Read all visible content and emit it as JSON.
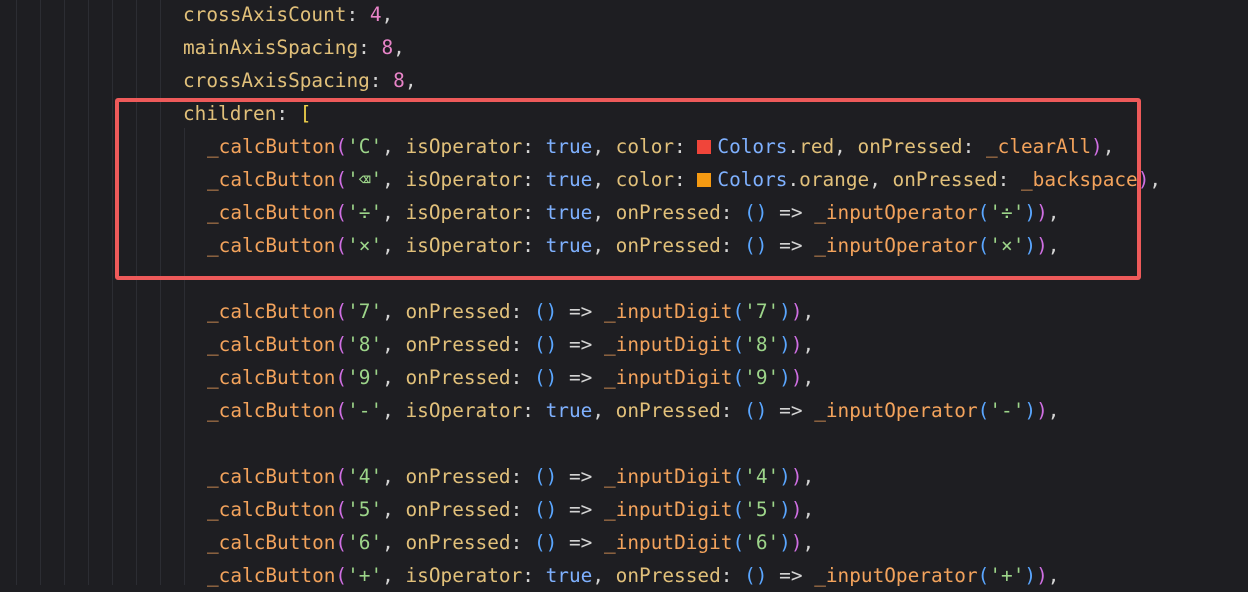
{
  "code": {
    "lines": [
      {
        "id": "l1",
        "text": "crossAxisCount: 4,"
      },
      {
        "id": "l2",
        "text": "mainAxisSpacing: 8,"
      },
      {
        "id": "l3",
        "text": "crossAxisSpacing: 8,"
      },
      {
        "id": "l4",
        "text": "children: ["
      },
      {
        "id": "l5",
        "text": "_calcButton('C', isOperator: true, color: Colors.red, onPressed: _clearAll),"
      },
      {
        "id": "l6",
        "text": "_calcButton('⌫', isOperator: true, color: Colors.orange, onPressed: _backspace),"
      },
      {
        "id": "l7",
        "text": "_calcButton('÷', isOperator: true, onPressed: () => _inputOperator('÷')),"
      },
      {
        "id": "l8",
        "text": "_calcButton('×', isOperator: true, onPressed: () => _inputOperator('×')),"
      },
      {
        "id": "l9",
        "text": "_calcButton('7', onPressed: () => _inputDigit('7')),"
      },
      {
        "id": "l10",
        "text": "_calcButton('8', onPressed: () => _inputDigit('8')),"
      },
      {
        "id": "l11",
        "text": "_calcButton('9', onPressed: () => _inputDigit('9')),"
      },
      {
        "id": "l12",
        "text": "_calcButton('-', isOperator: true, onPressed: () => _inputOperator('-')),"
      },
      {
        "id": "l13",
        "text": "_calcButton('4', onPressed: () => _inputDigit('4')),"
      },
      {
        "id": "l14",
        "text": "_calcButton('5', onPressed: () => _inputDigit('5')),"
      },
      {
        "id": "l15",
        "text": "_calcButton('6', onPressed: () => _inputDigit('6')),"
      },
      {
        "id": "l16",
        "text": "_calcButton('+', isOperator: true, onPressed: () => _inputOperator('+')),"
      }
    ]
  },
  "colors": {
    "background": "#1e1e22",
    "highlight_border": "#ee5a5a",
    "red_swatch": "#f0453a",
    "orange_swatch": "#f59a12"
  },
  "tokens": {
    "crossAxisCount": "crossAxisCount",
    "mainAxisSpacing": "mainAxisSpacing",
    "crossAxisSpacing": "crossAxisSpacing",
    "children": "children",
    "calcButton": "_calcButton",
    "isOperator": "isOperator",
    "true": "true",
    "color": "color",
    "onPressed": "onPressed",
    "Colors": "Colors",
    "red": "red",
    "orange": "orange",
    "clearAll": "_clearAll",
    "backspace": "_backspace",
    "inputOperator": "_inputOperator",
    "inputDigit": "_inputDigit",
    "arrow": "=>",
    "v4": "4",
    "v8": "8",
    "sC": "'C'",
    "sBack": "'⌫'",
    "sDiv": "'÷'",
    "sMul": "'×'",
    "s7": "'7'",
    "s8": "'8'",
    "s9": "'9'",
    "sMinus": "'-'",
    "s4": "'4'",
    "s5": "'5'",
    "s6": "'6'",
    "sPlus": "'+'"
  }
}
